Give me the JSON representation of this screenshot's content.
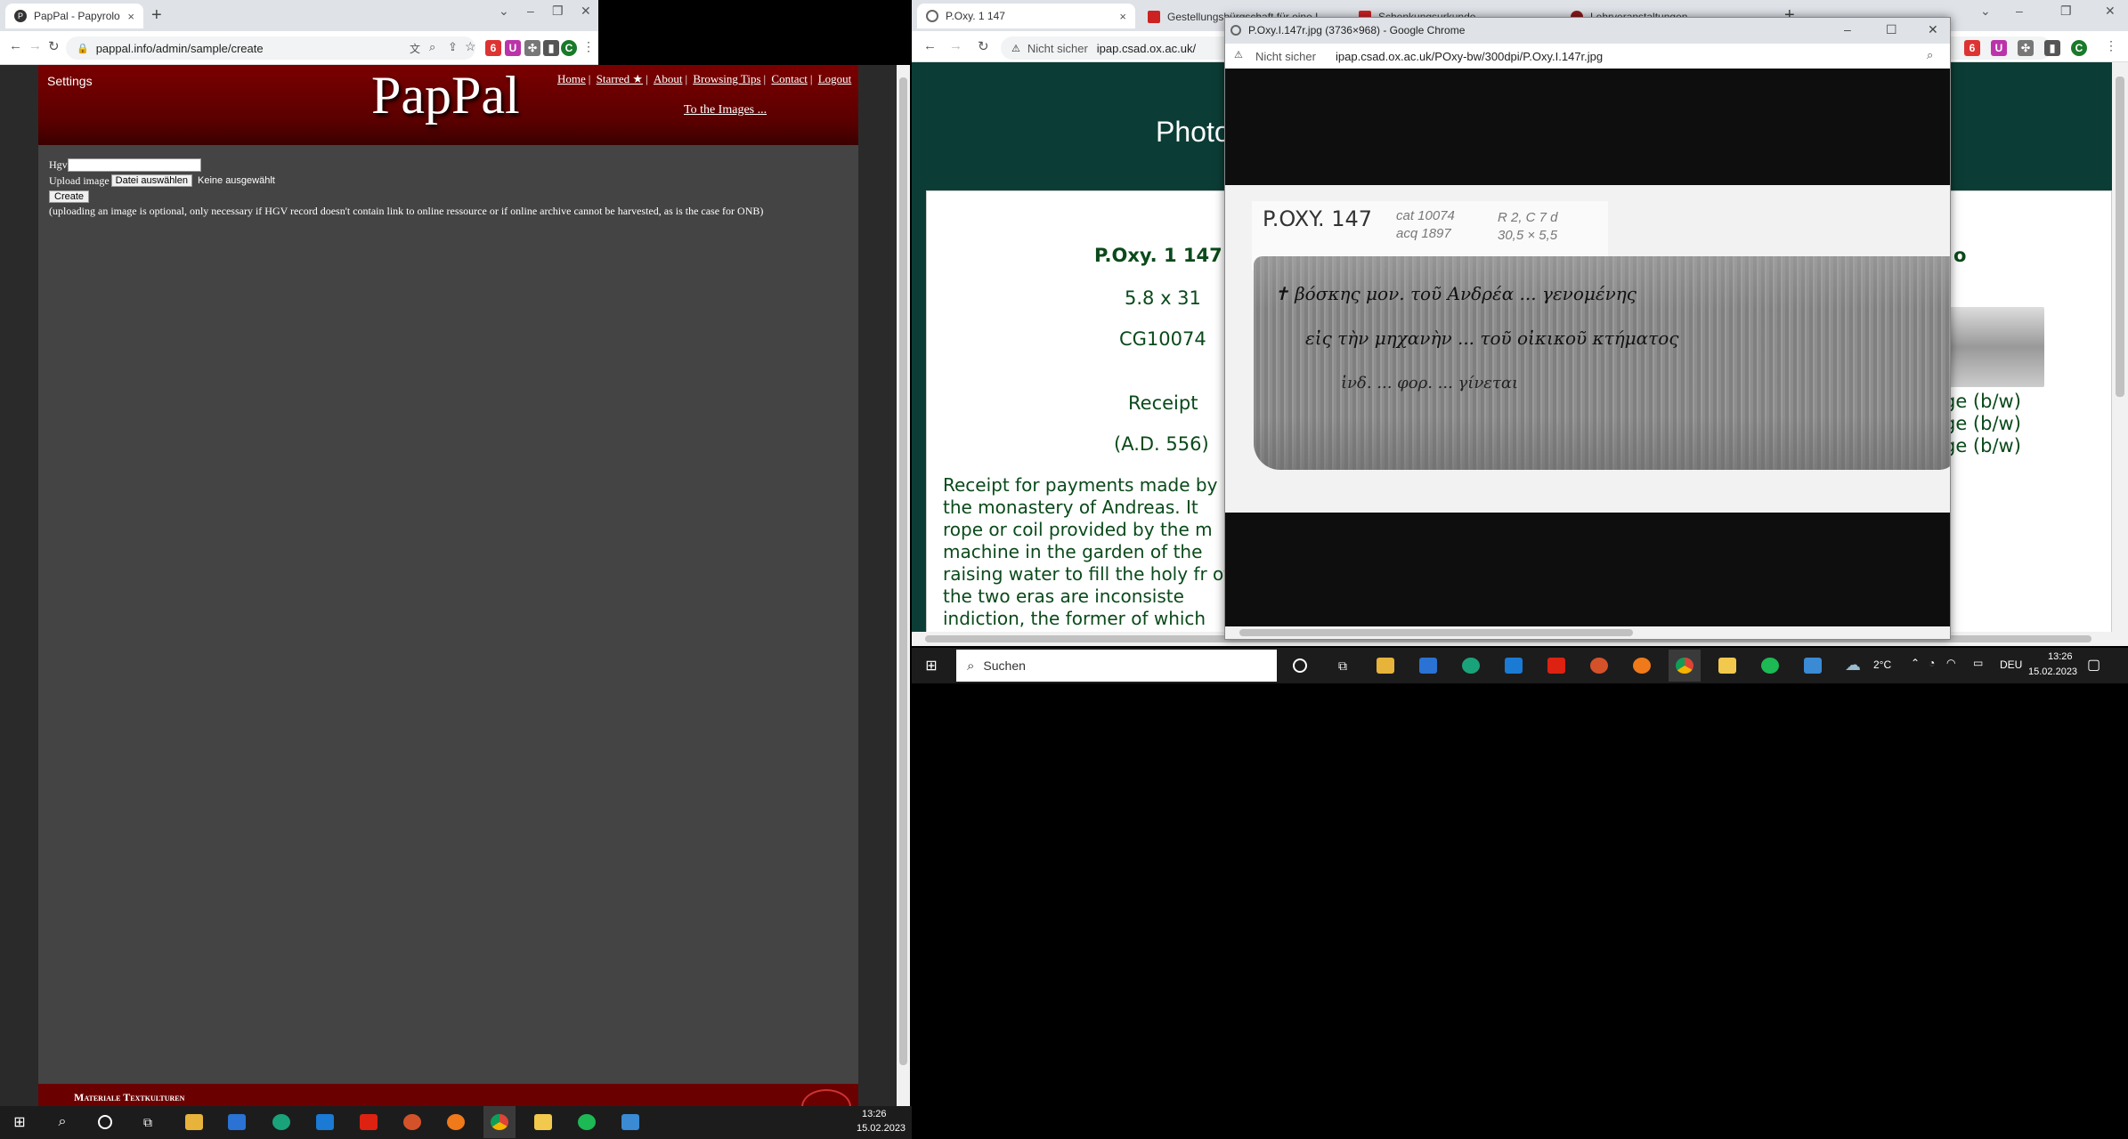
{
  "left_browser": {
    "tab": {
      "title": "PapPal - Papyrology | Paleograph",
      "close": "×"
    },
    "new_tab": "+",
    "window_controls": {
      "dropdown": "⌄",
      "minimize": "–",
      "restore": "❐",
      "close": "✕"
    },
    "url": "pappal.info/admin/sample/create",
    "profile_letter": "C"
  },
  "pappal": {
    "settings": "Settings",
    "logo": "PapPal",
    "nav": [
      "Home",
      "Starred ★",
      "About",
      "Browsing Tips",
      "Contact",
      "Logout"
    ],
    "separator": "|",
    "to_images": "To the Images ...",
    "form": {
      "hgv_label": "Hgv",
      "upload_label": "Upload image",
      "file_button": "Datei auswählen",
      "no_file": "Keine ausgewählt",
      "create_button": "Create",
      "note": "(uploading an image is optional, only necessary if HGV record doesn't contain link to online ressource or if online archive cannot be harvested, as is the case for ONB)"
    },
    "footer_text": "Materiale Textkulturen"
  },
  "right_browser": {
    "tabs": [
      "P.Oxy. 1 147",
      "Gestellungsbürgschaft für eine L",
      "Schenkungsurkunde",
      "Lehrveranstaltungen"
    ],
    "new_tab": "+",
    "security": "Nicht sicher",
    "url": "ipap.csad.ox.ac.uk/",
    "profile_letter": "C",
    "page": {
      "heading": "Photo",
      "title": "P.Oxy. 1 147",
      "dimensions": "5.8 x 31",
      "inventory": "CG10074",
      "type": "Receipt",
      "date": "(A.D. 556)",
      "description": "Receipt for payments made by the monastery of Andreas. It rope or coil provided by the m machine in the garden of the raising water to fill the holy fr of the two eras are inconsiste indiction, the former of which",
      "right_letter": "o",
      "image_links": [
        "ge (b/w)",
        "ge (b/w)",
        "ge (b/w)"
      ]
    }
  },
  "popup": {
    "title": "P.Oxy.I.147r.jpg (3736×968) - Google Chrome",
    "security": "Nicht sicher",
    "url": "ipap.csad.ox.ac.uk/POxy-bw/300dpi/P.Oxy.I.147r.jpg",
    "label_main": "P.OXY. 147",
    "label_cat": "cat 10074",
    "label_acq": "acq 1897",
    "label_loc": "R 2, C 7 d",
    "label_size": "30,5 × 5,5",
    "greek_line_1": "✝ βόσκης μον. τοῦ Ανδρέα ... γενομένης",
    "greek_line_2": "εἰς τὴν μηχανὴν ... τοῦ οἰκικοῦ κτήματος",
    "greek_line_3": "ἰνδ. ... φορ. ... γίνεται"
  },
  "taskbar_left": {
    "time": "13:26",
    "date": "15.02.2023"
  },
  "taskbar_right": {
    "search": "Suchen",
    "weather": "2°C",
    "lang": "DEU",
    "time": "13:26",
    "date": "15.02.2023"
  },
  "colors": {
    "pappal_dark_red": "#6b0000",
    "pappal_bg": "#444444",
    "oxford_green": "#0b3d36",
    "title_green": "#0a4a1a"
  }
}
